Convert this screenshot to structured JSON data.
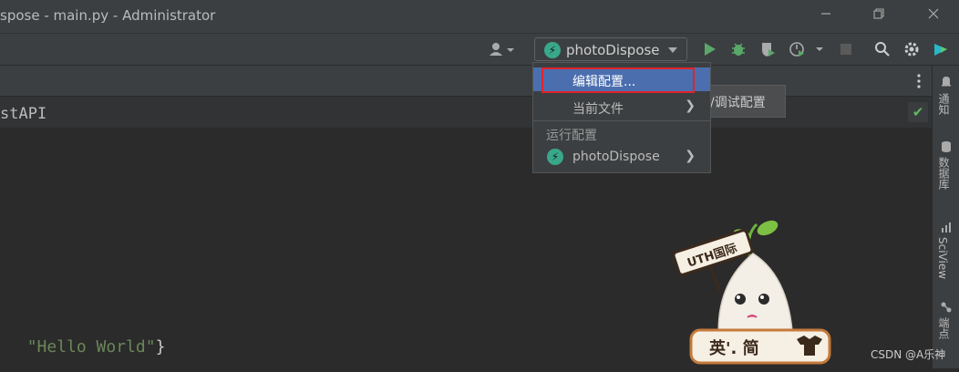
{
  "window": {
    "title": "spose - main.py - Administrator"
  },
  "toolbar": {
    "run_config": "photoDispose"
  },
  "editor": {
    "header_text": "stAPI",
    "code_string": "\"Hello World\"",
    "code_brace": "}"
  },
  "menu": {
    "items": [
      {
        "label": "编辑配置..."
      },
      {
        "label": "当前文件"
      }
    ],
    "section_label": "运行配置",
    "config_item": "photoDispose"
  },
  "tooltip": {
    "text": "/调试配置"
  },
  "right_sidebar": {
    "items": [
      "通知",
      "数据库",
      "SciView",
      "端点"
    ]
  },
  "sticker": {
    "badge": "UTH国际",
    "caption": "英'. 简"
  },
  "watermark": "CSDN @A乐神",
  "colors": {
    "background": "#2b2b2b",
    "panel": "#3c3f41",
    "selection": "#4b6eaf",
    "highlight_box": "#e0242c",
    "string": "#6a8759"
  }
}
